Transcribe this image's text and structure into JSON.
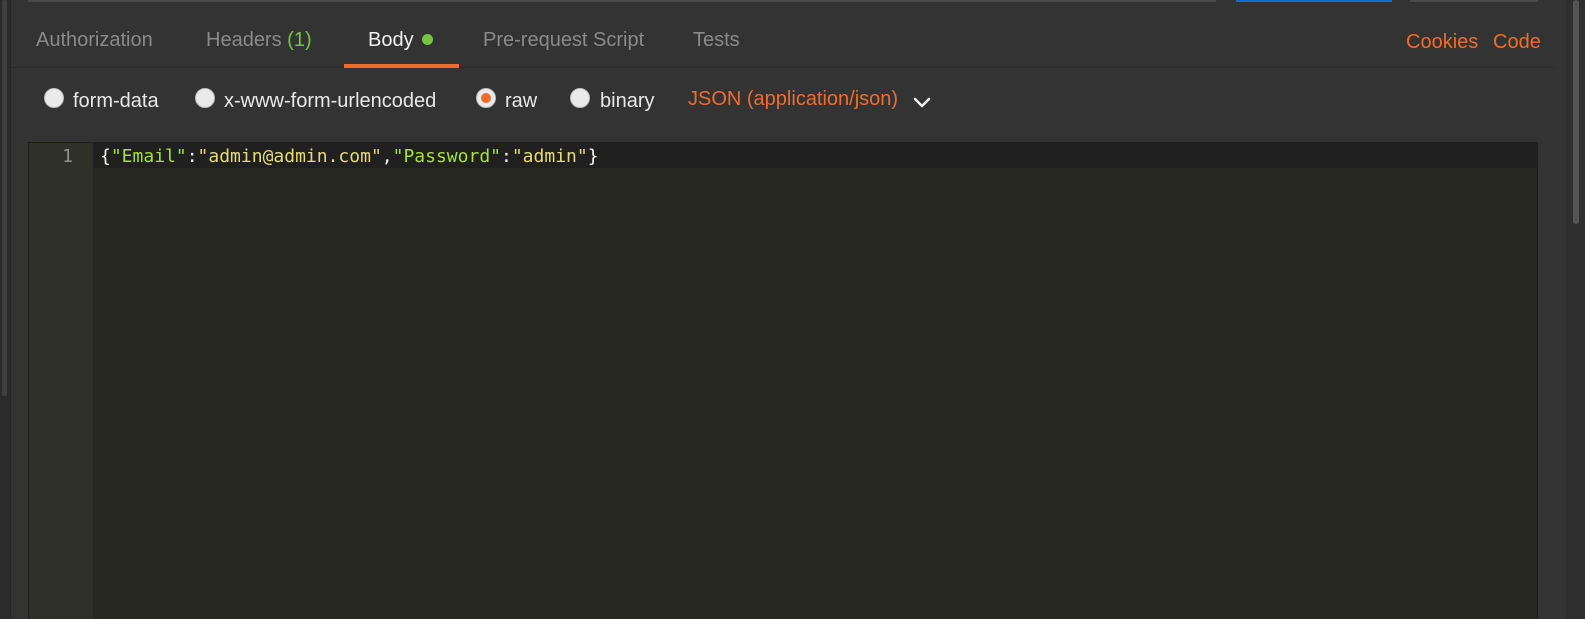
{
  "tabs": {
    "authorization": "Authorization",
    "headers": "Headers",
    "headers_count": "(1)",
    "body": "Body",
    "prerequest": "Pre-request Script",
    "tests": "Tests"
  },
  "links": {
    "cookies": "Cookies",
    "code": "Code"
  },
  "body_types": {
    "form_data": "form-data",
    "urlencoded": "x-www-form-urlencoded",
    "raw": "raw",
    "binary": "binary",
    "selected": "raw"
  },
  "format": {
    "label": "JSON (application/json)",
    "icon": "chevron-down-icon"
  },
  "editor": {
    "line_number": "1",
    "tokens": {
      "open_brace": "{",
      "key1": "\"Email\"",
      "colon1": ":",
      "val1": "\"admin@admin.com\"",
      "comma": ",",
      "key2": "\"Password\"",
      "colon2": ":",
      "val2": "\"admin\"",
      "close_brace": "}"
    }
  },
  "colors": {
    "accent": "#ef6c2b",
    "success": "#76c442",
    "background": "#333333",
    "editor_background": "#272822"
  }
}
